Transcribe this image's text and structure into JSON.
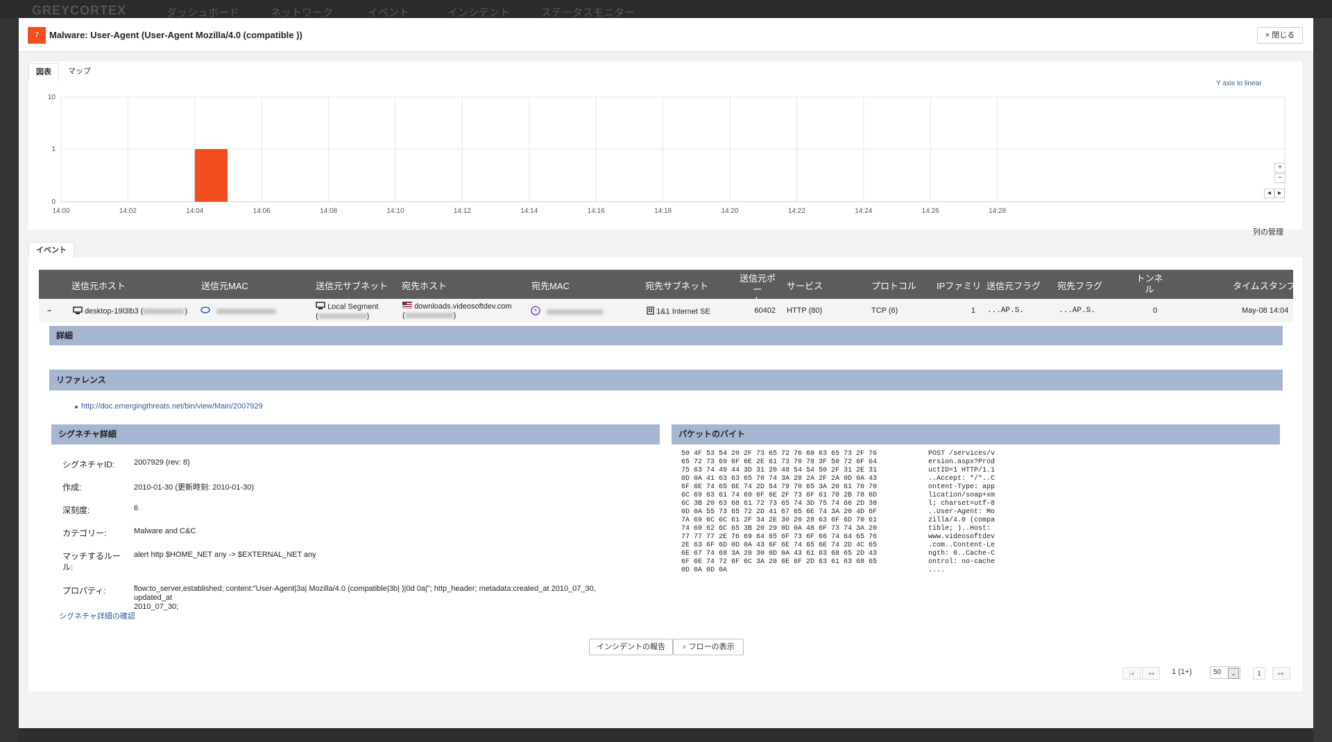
{
  "background": {
    "logo": "GREYCORTEX",
    "nav": [
      "ダッシュボード",
      "ネットワーク",
      "イベント",
      "インシデント",
      "ステータスモニター"
    ]
  },
  "modal": {
    "severity": "7",
    "title": "Malware: User-Agent (User-Agent Mozilla/4.0 (compatible ))",
    "close_label": "× 閉じる"
  },
  "top_tabs": [
    "図表",
    "マップ"
  ],
  "chart_data": {
    "type": "bar",
    "y_scale": "log",
    "y_ticks": [
      "10",
      "1",
      "0"
    ],
    "x_ticks": [
      "14:00",
      "14:02",
      "14:04",
      "14:06",
      "14:08",
      "14:10",
      "14:12",
      "14:14",
      "14:16",
      "14:18",
      "14:20",
      "14:22",
      "14:24",
      "14:26",
      "14:28"
    ],
    "bars": [
      {
        "x": "14:04",
        "x_end": "14:05",
        "value": 1
      }
    ],
    "bar_color": "#f24e1e",
    "grid": true,
    "axis_toggle_label": "Y axis to linear",
    "zoom_in": "+",
    "zoom_out": "−",
    "pan_left": "◂",
    "pan_right": "▸"
  },
  "events_tab": "イベント",
  "column_manager": "列の管理",
  "table": {
    "headers": {
      "src_host": "送信元ホスト",
      "src_mac": "送信元MAC",
      "src_subnet": "送信元サブネット",
      "dst_host": "宛先ホスト",
      "dst_mac": "宛先MAC",
      "dst_subnet": "宛先サブネット",
      "src_port_1": "送信元ポー",
      "src_port_2": "ト",
      "service": "サービス",
      "protocol": "プロトコル",
      "ip_family": "IPファミリ",
      "src_flags": "送信元フラグ",
      "dst_flags": "宛先フラグ",
      "tunnel_1": "トンネ",
      "tunnel_2": "ル",
      "timestamp": "タイムスタンプ"
    },
    "row": {
      "expand": "–",
      "src_host": "desktop-19l3lb3 (",
      "src_host_close": ")",
      "src_subnet": "Local Segment",
      "src_subnet_open": "(",
      "src_subnet_close": ")",
      "dst_host": "downloads.videosoftdev.com",
      "dst_host_open": "(",
      "dst_host_close": ")",
      "dst_subnet": "1&1 Internet SE",
      "src_port": "60402",
      "service": "HTTP (80)",
      "protocol": "TCP (6)",
      "ip_family": "1",
      "src_flags": "...AP.S.",
      "dst_flags": "...AP.S.",
      "tunnel": "0",
      "timestamp": "May-08 14:04"
    }
  },
  "details_label": "詳細",
  "references_label": "リファレンス",
  "reference_link": "http://doc.emergingthreats.net/bin/view/Main/2007929",
  "signature": {
    "header": "シグネチャ詳細",
    "id_label": "シグネチャID:",
    "id_value": "2007929 (rev: 8)",
    "created_label": "作成:",
    "created_value": "2010-01-30 (更新時刻: 2010-01-30)",
    "severity_label": "深刻度:",
    "severity_value": "6",
    "category_label": "カテゴリー:",
    "category_value": "Malware and C&C",
    "rule_label_1": "マッチするルー",
    "rule_label_2": "ル:",
    "rule_value": "alert http $HOME_NET any -> $EXTERNAL_NET any",
    "props_label": "プロパティ:",
    "props_value_1": "flow:to_server,established; content:\"User-Agent|3a| Mozilla/4.0 (compatible|3b| )|0d 0a|\"; http_header; metadata:created_at 2010_07_30, updated_at",
    "props_value_2": "2010_07_30;",
    "confirm_link": "シグネチャ詳細の確認"
  },
  "packet": {
    "header": "パケットのバイト",
    "hex": "50 4F 53 54 20 2F 73 65 72 76 69 63 65 73 2F 76\n65 72 73 69 6F 6E 2E 61 73 70 78 3F 50 72 6F 64\n75 63 74 49 44 3D 31 20 48 54 54 50 2F 31 2E 31\n0D 0A 41 63 63 65 70 74 3A 20 2A 2F 2A 0D 0A 43\n6F 6E 74 65 6E 74 2D 54 79 70 65 3A 20 61 70 70\n6C 69 63 61 74 69 6F 6E 2F 73 6F 61 70 2B 78 6D\n6C 3B 20 63 68 61 72 73 65 74 3D 75 74 66 2D 38\n0D 0A 55 73 65 72 2D 41 67 65 6E 74 3A 20 4D 6F\n7A 69 6C 6C 61 2F 34 2E 30 20 28 63 6F 6D 70 61\n74 69 62 6C 65 3B 20 29 0D 0A 48 6F 73 74 3A 20\n77 77 77 2E 76 69 64 65 6F 73 6F 66 74 64 65 76\n2E 63 6F 6D 0D 0A 43 6F 6E 74 65 6E 74 2D 4C 65\n6E 67 74 68 3A 20 30 0D 0A 43 61 63 68 65 2D 43\n6F 6E 74 72 6F 6C 3A 20 6E 6F 2D 63 61 63 68 65\n0D 0A 0D 0A",
    "ascii": "POST /services/v\nersion.aspx?Prod\nuctID=1 HTTP/1.1\n..Accept: */*..C\nontent-Type: app\nlication/soap+xm\nl; charset=utf-8\n..User-Agent: Mo\nzilla/4.0 (compa\ntible; )..Host: \nwww.videosoftdev\n.com..Content-Le\nngth: 0..Cache-C\nontrol: no-cache\n...."
  },
  "actions": {
    "report_incident": "インシデントの報告",
    "show_flows": "⌕ フローの表示"
  },
  "pagination": {
    "first": "|◂",
    "prev": "◂◂",
    "info": "1 (1+)",
    "page_size": "50",
    "page": "1",
    "next": "▸▸"
  }
}
